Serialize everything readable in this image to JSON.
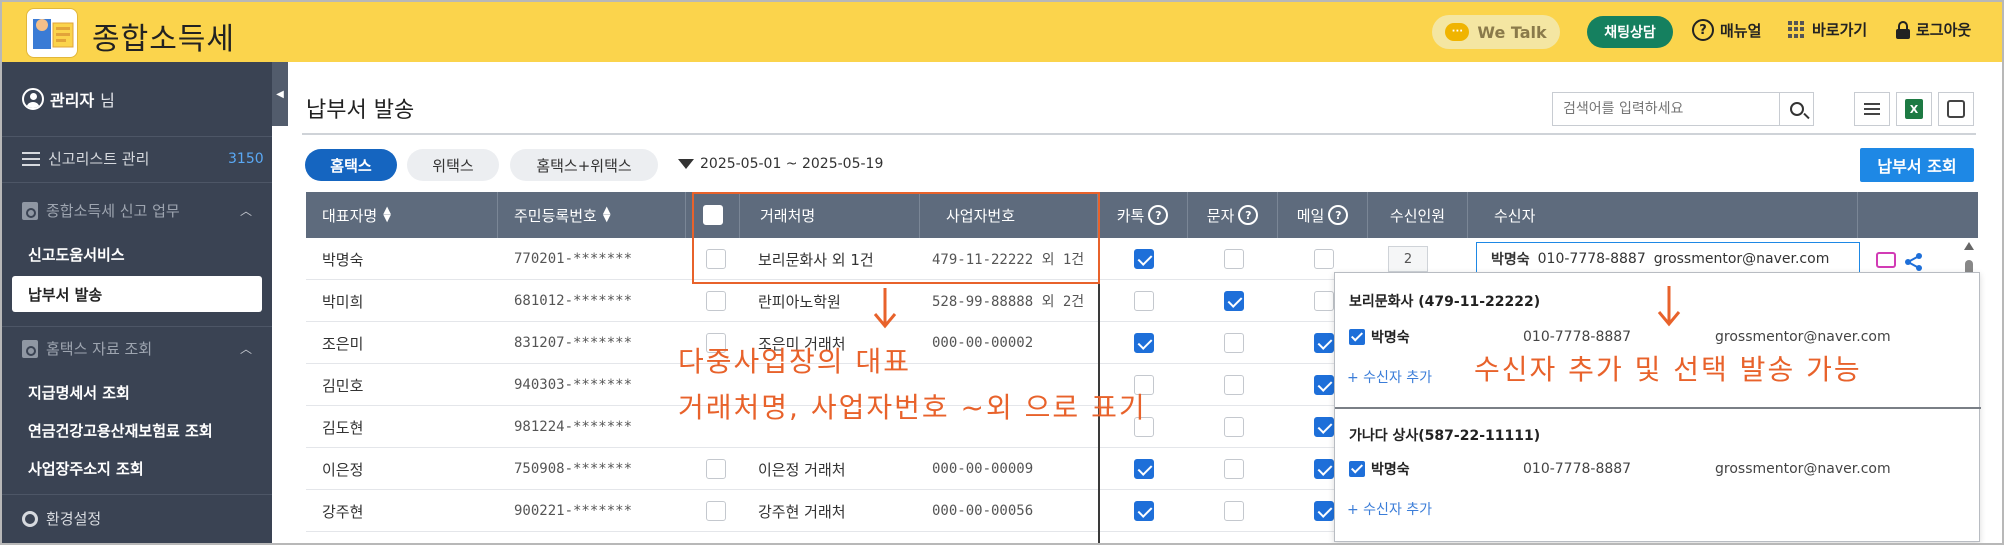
{
  "header": {
    "app_title": "종합소득세",
    "wetalk_label": "We Talk",
    "chat_consult_label": "채팅상담",
    "manual_label": "매뉴얼",
    "shortcut_label": "바로가기",
    "logout_label": "로그아웃",
    "accent_color": "#fbd44c"
  },
  "sidebar": {
    "user_name": "관리자",
    "user_suffix": "님",
    "report_list_label": "신고리스트 관리",
    "report_list_count": "3150",
    "group1_label": "종합소득세 신고 업무",
    "group1_items": [
      "신고도움서비스",
      "납부서 발송"
    ],
    "group2_label": "홈택스 자료 조회",
    "group2_items": [
      "지급명세서 조회",
      "연금건강고용산재보험료 조회",
      "사업장주소지 조회"
    ],
    "settings_label": "환경설정"
  },
  "main": {
    "page_title": "납부서 발송",
    "search_placeholder": "검색어를 입력하세요",
    "tabs": [
      "홈택스",
      "위택스",
      "홈택스+위택스"
    ],
    "date_range": "2025-05-01 ~ 2025-05-19",
    "issue_button": "납부서 조회"
  },
  "table": {
    "headers": {
      "rep_name": "대표자명",
      "resident_no": "주민등록번호",
      "vendor": "거래처명",
      "biz_no": "사업자번호",
      "kakao": "카톡",
      "sms": "문자",
      "mail": "메일",
      "recipients_count": "수신인원",
      "recipient": "수신자"
    },
    "rows": [
      {
        "name": "박명숙",
        "rrn": "770201-*******",
        "vendor": "보리문화사 외 1건",
        "biz": "479-11-22222 외 1건",
        "kakao": true,
        "sms": false,
        "mail": false
      },
      {
        "name": "박미희",
        "rrn": "681012-*******",
        "vendor": "란피아노학원",
        "biz": "528-99-88888 외 2건",
        "kakao": false,
        "sms": true,
        "mail": false
      },
      {
        "name": "조은미",
        "rrn": "831207-*******",
        "vendor": "조은미 거래처",
        "biz": "000-00-00002",
        "kakao": true,
        "sms": false,
        "mail": true
      },
      {
        "name": "김민호",
        "rrn": "940303-*******",
        "vendor": "",
        "biz": "",
        "kakao": false,
        "sms": false,
        "mail": true
      },
      {
        "name": "김도현",
        "rrn": "981224-*******",
        "vendor": "",
        "biz": "",
        "kakao": false,
        "sms": false,
        "mail": true
      },
      {
        "name": "이은정",
        "rrn": "750908-*******",
        "vendor": "이은정 거래처",
        "biz": "000-00-00009",
        "kakao": true,
        "sms": false,
        "mail": true
      },
      {
        "name": "강주현",
        "rrn": "900221-*******",
        "vendor": "강주현 거래처",
        "biz": "000-00-00056",
        "kakao": true,
        "sms": false,
        "mail": true
      }
    ],
    "first_row_count": "2",
    "first_row_recipient_name": "박명숙",
    "first_row_recipient_phone": "010-7778-8887",
    "first_row_recipient_email": "grossmentor@naver.com"
  },
  "popup": {
    "sections": [
      {
        "title": "보리문화사 (479-11-22222)",
        "person": "박명숙",
        "phone": "010-7778-8887",
        "email": "grossmentor@naver.com",
        "add_label": "+ 수신자 추가"
      },
      {
        "title": "가나다 상사(587-22-11111)",
        "person": "박명숙",
        "phone": "010-7778-8887",
        "email": "grossmentor@naver.com",
        "add_label": "+ 수신자 추가"
      }
    ]
  },
  "annotations": {
    "left_line1": "다중사업장의 대표",
    "left_line2": "거래처명, 사업자번호 ~외 으로 표기",
    "right": "수신자 추가 및 선택 발송 가능",
    "color": "#e8622b"
  }
}
